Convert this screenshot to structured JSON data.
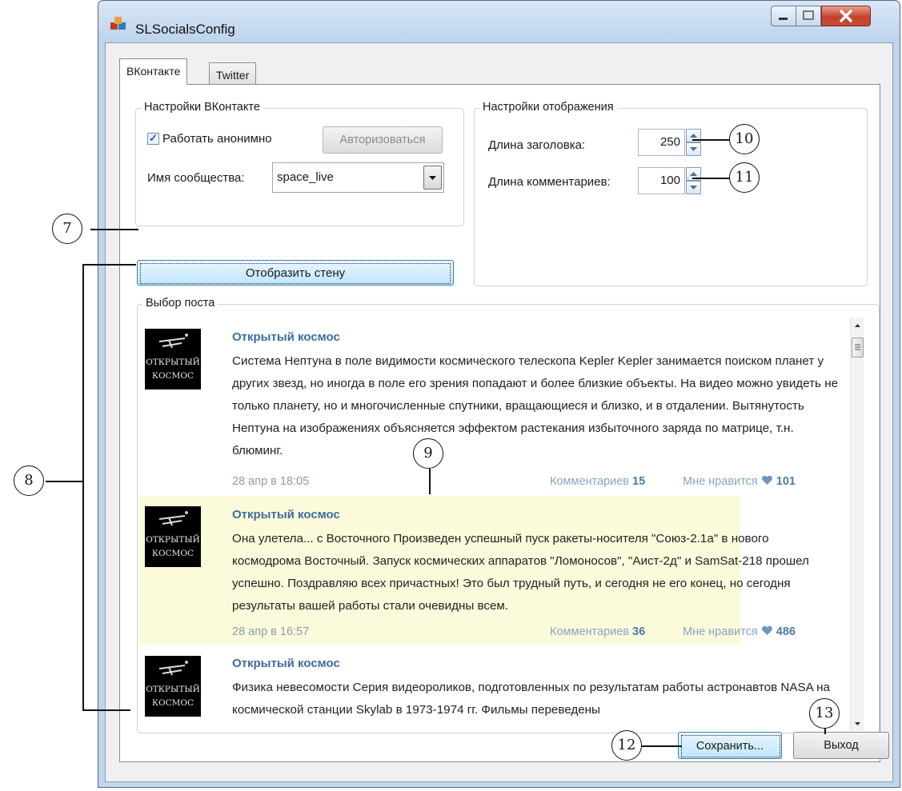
{
  "window": {
    "title": "SLSocialsConfig"
  },
  "tabs": [
    {
      "label": "ВКонтакте"
    },
    {
      "label": "Twitter"
    }
  ],
  "vk_settings": {
    "legend": "Настройки ВКонтакте",
    "anonymous_label": "Работать анонимно",
    "anonymous_checked": true,
    "authorize_label": "Авторизоваться",
    "community_label": "Имя сообщества:",
    "community_value": "space_live"
  },
  "display_settings": {
    "legend": "Настройки отображения",
    "title_length_label": "Длина заголовка:",
    "title_length_value": "250",
    "comments_length_label": "Длина комментариев:",
    "comments_length_value": "100"
  },
  "show_wall_label": "Отобразить стену",
  "post_select": {
    "legend": "Выбор поста",
    "avatar_text": "ОТКРЫТЫЙ КОСМОС",
    "posts": [
      {
        "author": "Открытый космос",
        "text": "Система Нептуна в поле видимости космического телескопа Kepler Kepler занимается поиском планет у других звезд, но иногда в поле его зрения попадают и более близкие объекты. На видео можно увидеть не только планету, но и многочисленные спутники, вращающиеся и близко, и в отдалении. Вытянутость Нептуна на изображениях объясняется эффектом растекания избыточного заряда по матрице, т.н. блюминг.",
        "date": "28 апр в 18:05",
        "comments_label": "Комментариев",
        "comments": "15",
        "likes_label": "Мне нравится",
        "likes": "101",
        "highlighted": false
      },
      {
        "author": "Открытый космос",
        "text": "Она улетела... с Восточного Произведен успешный пуск ракеты-носителя \"Союз-2.1а\" в нового космодрома Восточный. Запуск космических аппаратов \"Ломоносов\", \"Аист-2д\" и SamSat-218 прошел успешно. Поздравляю всех причастных! Это был трудный путь, и сегодня не его конец, но сегодня результаты вашей работы стали очевидны всем.",
        "date": "28 апр в 16:57",
        "comments_label": "Комментариев",
        "comments": "36",
        "likes_label": "Мне нравится",
        "likes": "486",
        "highlighted": true
      },
      {
        "author": "Открытый космос",
        "text": "Физика невесомости Серия видеороликов, подготовленных по результатам работы астронавтов NASA на космической станции Skylab в 1973-1974 гг. Фильмы переведены",
        "highlighted": false
      }
    ]
  },
  "buttons": {
    "save_label": "Сохранить...",
    "exit_label": "Выход"
  },
  "callouts": [
    "7",
    "8",
    "9",
    "10",
    "11",
    "12",
    "13"
  ],
  "colors": {
    "accent": "#3c6d9d",
    "highlight": "#fbfbdb",
    "like": "#6f95c4"
  }
}
